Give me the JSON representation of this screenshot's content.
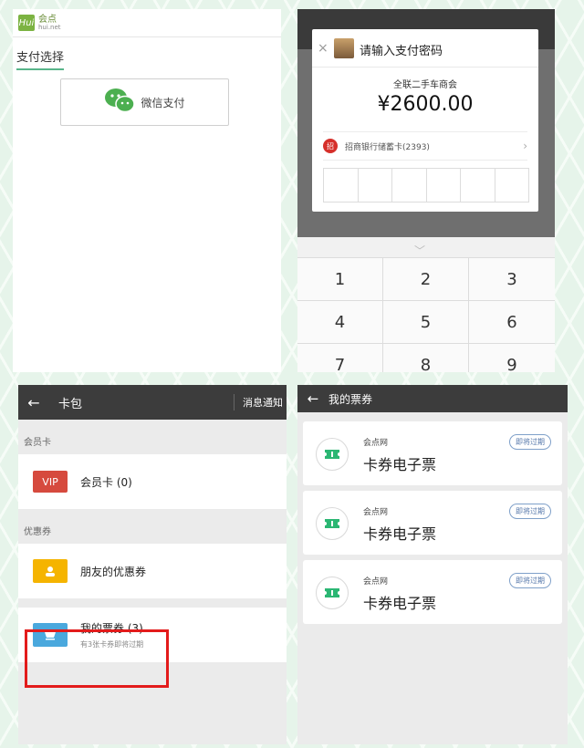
{
  "panel1": {
    "logo_mark": "Hui",
    "logo_cn": "会点",
    "logo_en": "hui.net",
    "pay_title": "支付选择",
    "wechat_pay_label": "微信支付",
    "wechat_color": "#4caf50"
  },
  "panel2": {
    "dialog_title": "请输入支付密码",
    "close_glyph": "×",
    "merchant": "全联二手车商会",
    "amount": "¥2600.00",
    "bank_logo": "招",
    "bank_card": "招商银行储蓄卡(2393)",
    "keys": [
      "1",
      "2",
      "3",
      "4",
      "5",
      "6",
      "7",
      "8",
      "9"
    ]
  },
  "panel3": {
    "title": "卡包",
    "right_link": "消息通知",
    "section_member": "会员卡",
    "vip_badge": "VIP",
    "member_item": "会员卡 (0)",
    "section_coupon": "优惠券",
    "friends_coupon": "朋友的优惠券",
    "my_tickets": "我的票券 (3)",
    "my_tickets_sub": "有3张卡券即将过期",
    "highlight_color": "#e31b1b"
  },
  "panel4": {
    "title": "我的票券",
    "tickets": [
      {
        "merchant": "会点网",
        "name": "卡券电子票",
        "badge": "即将过期"
      },
      {
        "merchant": "会点网",
        "name": "卡券电子票",
        "badge": "即将过期"
      },
      {
        "merchant": "会点网",
        "name": "卡券电子票",
        "badge": "即将过期"
      }
    ],
    "ticket_icon_color": "#2bb673"
  }
}
